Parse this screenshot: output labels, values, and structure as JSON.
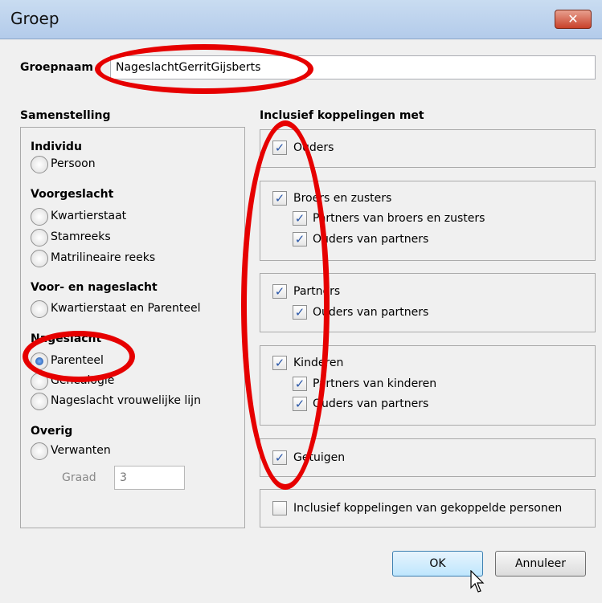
{
  "window": {
    "title": "Groep",
    "close_glyph": "✕"
  },
  "groepnaam": {
    "label": "Groepnaam",
    "value": "NageslachtGerritGijsberts"
  },
  "samenstelling": {
    "heading": "Samenstelling",
    "individu": {
      "heading": "Individu",
      "options": [
        "Persoon"
      ]
    },
    "voorgeslacht": {
      "heading": "Voorgeslacht",
      "options": [
        "Kwartierstaat",
        "Stamreeks",
        "Matrilineaire reeks"
      ]
    },
    "voor_en_nageslacht": {
      "heading": "Voor- en nageslacht",
      "options": [
        "Kwartierstaat en Parenteel"
      ]
    },
    "nageslacht": {
      "heading": "Nageslacht",
      "options": [
        "Parenteel",
        "Genealogie",
        "Nageslacht vrouwelijke lijn"
      ],
      "selected": "Parenteel"
    },
    "overig": {
      "heading": "Overig",
      "options": [
        "Verwanten"
      ],
      "graad_label": "Graad",
      "graad_value": "3"
    }
  },
  "inclusief": {
    "heading": "Inclusief koppelingen met",
    "ouders": {
      "label": "Ouders",
      "checked": true
    },
    "broers": {
      "label": "Broers en zusters",
      "checked": true,
      "sub": [
        {
          "label": "Partners van broers en zusters",
          "checked": true
        },
        {
          "label": "Ouders van partners",
          "checked": true
        }
      ]
    },
    "partners": {
      "label": "Partners",
      "checked": true,
      "sub": [
        {
          "label": "Ouders van partners",
          "checked": true
        }
      ]
    },
    "kinderen": {
      "label": "Kinderen",
      "checked": true,
      "sub": [
        {
          "label": "Partners van kinderen",
          "checked": true
        },
        {
          "label": "Ouders van partners",
          "checked": true
        }
      ]
    },
    "getuigen": {
      "label": "Getuigen",
      "checked": true
    },
    "gekoppelde": {
      "label": "Inclusief koppelingen van gekoppelde personen",
      "checked": false
    },
    "check_glyph": "✓"
  },
  "buttons": {
    "ok": "OK",
    "cancel": "Annuleer"
  },
  "colors": {
    "annotation": "#e60000",
    "check": "#2a57a8"
  }
}
